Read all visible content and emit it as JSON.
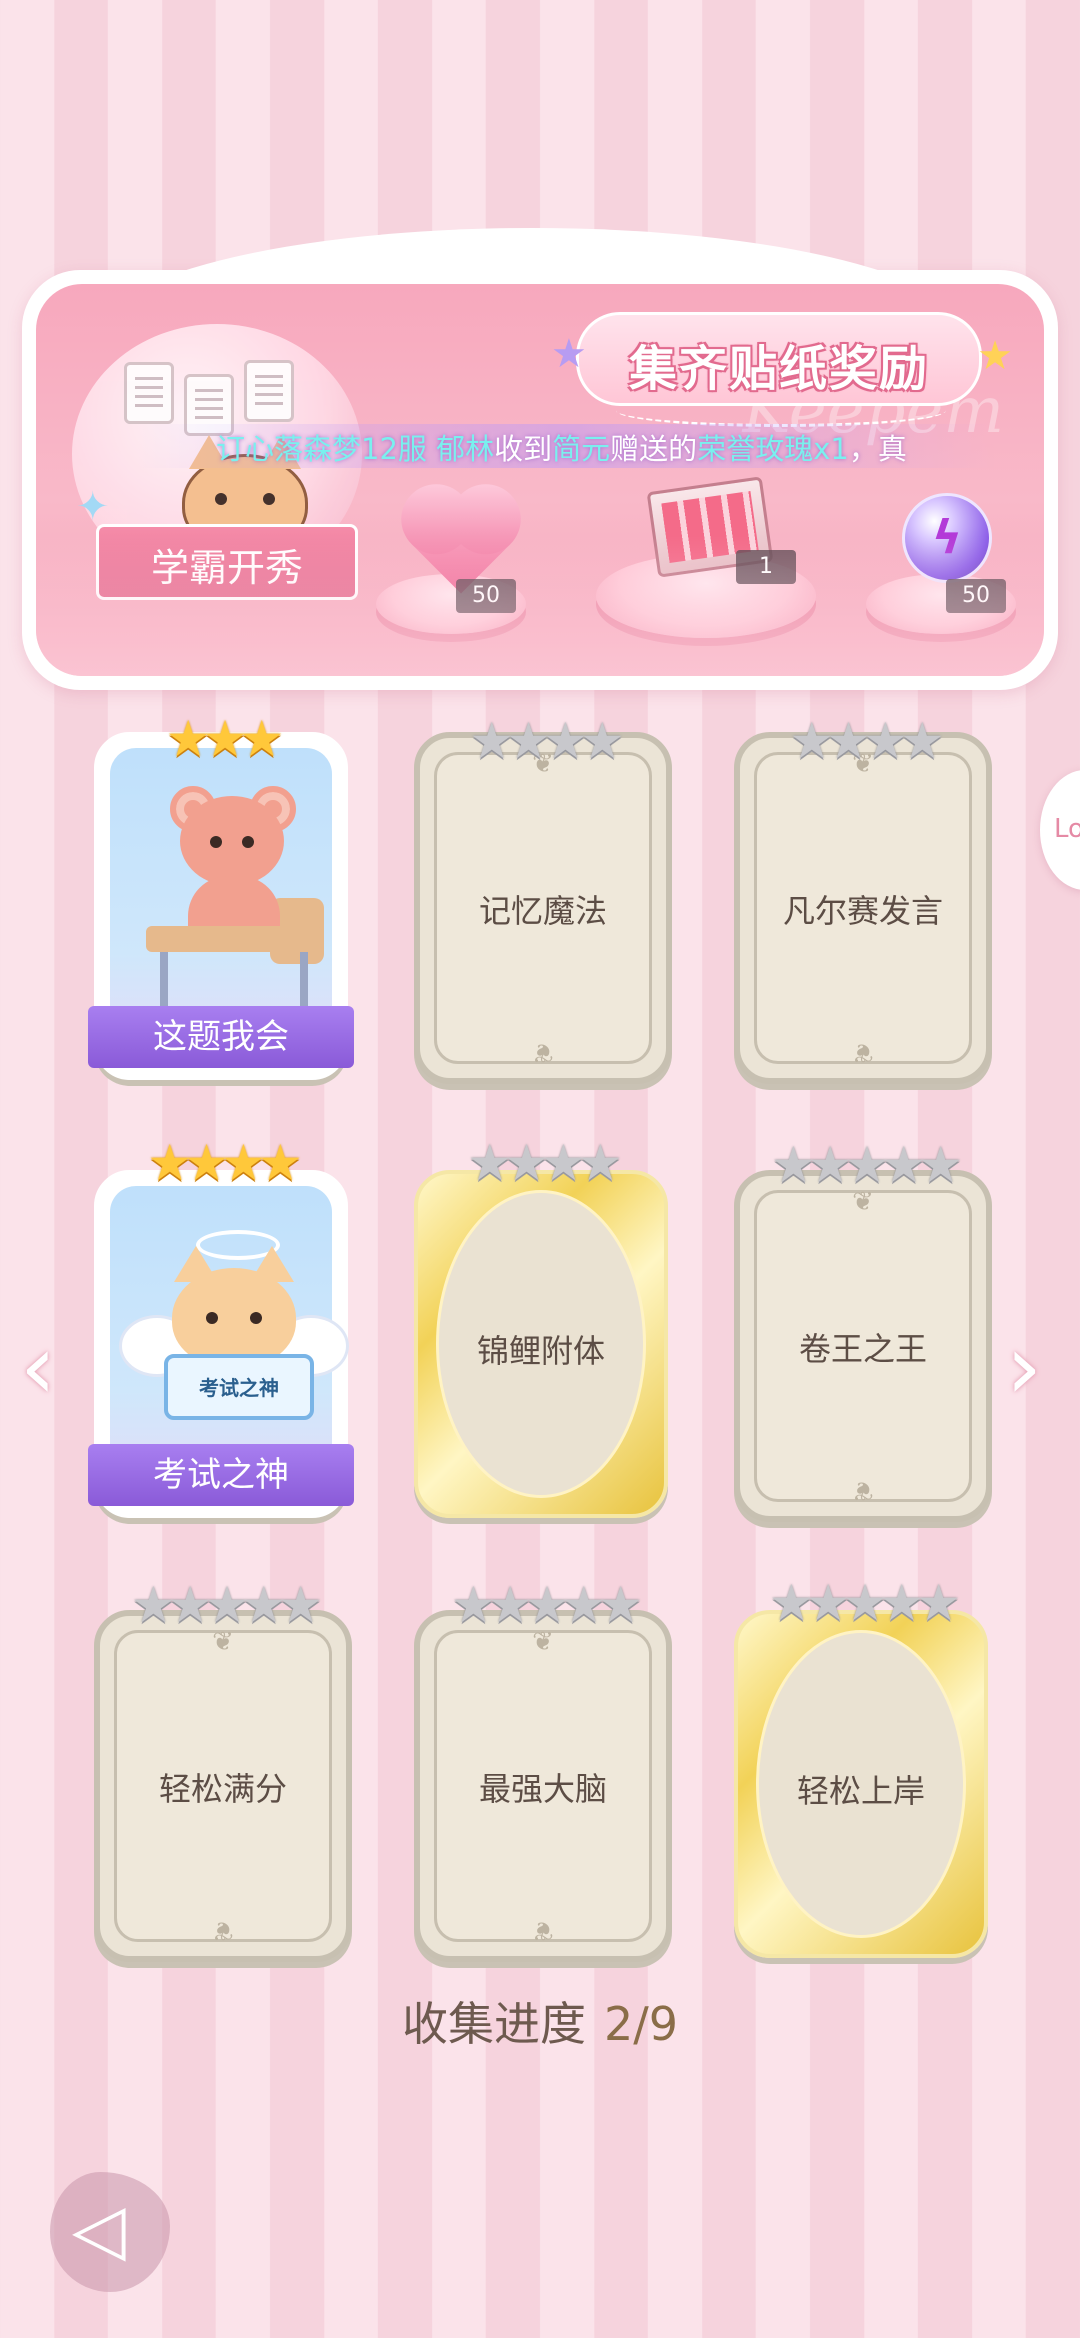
{
  "banner": {
    "title": "集齐贴纸奖励",
    "ribbon_label": "学霸开秀",
    "watermark": "Keepem",
    "ticker": {
      "prefix": "订心落森梦12服",
      "name1": "郁林",
      "middle1": "收到",
      "name2": "简元",
      "middle2": "赠送的",
      "gift": "荣誉玫瑰x1",
      "suffix": "，真"
    },
    "rewards": [
      {
        "icon": "heart-gem-icon",
        "count": "50"
      },
      {
        "icon": "gift-box-icon",
        "count": "1"
      },
      {
        "icon": "energy-orb-icon",
        "count": "50"
      }
    ]
  },
  "stickers": [
    {
      "label": "这题我会",
      "state": "collected",
      "stars": "★★★"
    },
    {
      "label": "记忆魔法",
      "state": "locked",
      "stars": "★★★★"
    },
    {
      "label": "凡尔赛发言",
      "state": "locked",
      "stars": "★★★★"
    },
    {
      "label": "考试之神",
      "state": "collected",
      "stars": "★★★★"
    },
    {
      "label": "锦鲤附体",
      "state": "locked-gold",
      "stars": "★★★★"
    },
    {
      "label": "卷王之王",
      "state": "locked",
      "stars": "★★★★★"
    },
    {
      "label": "轻松满分",
      "state": "locked",
      "stars": "★★★★★"
    },
    {
      "label": "最强大脑",
      "state": "locked",
      "stars": "★★★★★"
    },
    {
      "label": "轻松上岸",
      "state": "locked-gold",
      "stars": "★★★★★"
    }
  ],
  "sign_text": "考试之神",
  "progress": {
    "label": "收集进度",
    "value": "2/9"
  },
  "side_tab_label": "Lo",
  "colors": {
    "accent_pink": "#f7a8bd",
    "collected_plate": "#8a5ad8",
    "star_gold": "#ffc83a",
    "star_silver": "#c8c8cc"
  }
}
